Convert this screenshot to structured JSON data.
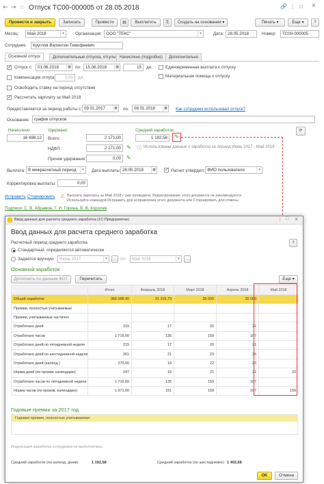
{
  "window": {
    "title": "Отпуск ТС00-000005 от 28.05.2018",
    "close": "×",
    "min": "–",
    "restore": "□"
  },
  "toolbar": {
    "post_close": "Провести и закрыть",
    "save": "Записать",
    "post": "Провести",
    "pay": "Выплатить",
    "create_basis": "Создать на основании",
    "print": "Печать",
    "more": "Еще",
    "help": "?"
  },
  "header": {
    "month_label": "Месяц:",
    "month": "Май 2018",
    "org_label": "Организация:",
    "org": "ООО \"ТЕКС\"",
    "date_label": "Дата:",
    "date": "28.05.2018",
    "number_label": "Номер:",
    "number": "ТС00-000005",
    "employee_label": "Сотрудник:",
    "employee": "Круглов Валентин Тимофеевич"
  },
  "tabs": [
    "Основной отпуск",
    "Дополнительные отпуска, отгулы",
    "Начислено (подробно)",
    "Дополнительно"
  ],
  "vacation": {
    "leave_label": "Отпуск с:",
    "from": "01.06.2018",
    "to_label": "по:",
    "to": "15.06.2018",
    "days": "15",
    "days_unit": "дн.",
    "comp_label": "Компенсация отпуска",
    "comp_value": "0,00",
    "comp_unit": "дн.",
    "free_rate": "Освободить ставку на период отсутствия",
    "calc_salary": "Рассчитать зарплату за Май 2018",
    "single_pay": "Единовременная выплата к отпуску",
    "material_help": "Материальная помощь к отпуску",
    "period_label": "Предоставляется за период работы с:",
    "period_from": "09.01.2017",
    "period_to_label": "по:",
    "period_to": "08.01.2018",
    "used_link": "Как сотрудник использовал отпуск?",
    "basis_label": "Основание:",
    "basis": "график отпусков"
  },
  "calc": {
    "accrued_label": "Начислено",
    "accrued": "16 696,12",
    "withheld_label": "Удержано",
    "total_label": "Всего:",
    "total": "2 171,00",
    "ndfl_label": "НДФЛ:",
    "ndfl": "2 171,00",
    "other_label": "Прочие удержания:",
    "other": "0,00",
    "avg_label": "Средний заработок",
    "avg": "1 192,58",
    "avg_note": "Использованы данные о заработке за период Июнь 2017 - Май 2018"
  },
  "payout": {
    "label": "Выплата:",
    "type": "В межрасчетный период",
    "date_label": "Дата выплаты:",
    "date": "28.05.2018",
    "approve_label": "Расчет утвердил:",
    "approver": "ФИО пользователя",
    "correction_label": "Корректировка выплаты:",
    "correction": "0,00"
  },
  "footer": {
    "fix": "Исправить",
    "reverse": "Сторнировать",
    "warning": "Выплата зарплаты за Май 2018 г уже проведена. Редактирование этого документа не рекомендуется",
    "warning2": "Используйте командой Исправить для исправления этого документа или Сторнировать для отмены",
    "signatures": "Подписи: С. В. Абрамов, Г. И. Горина, В. В. Королев"
  },
  "dialog": {
    "title_bar": "Ввод данных для расчета среднего заработка (1С:Предприятие)",
    "heading": "Ввод данных для расчета среднего заработка",
    "help": "?",
    "period_label": "Расчетный период среднего заработка",
    "standard": "Стандартный, определяется автоматически",
    "manual": "Задается вручную",
    "manual_from": "Июнь 2017",
    "manual_to_label": "по:",
    "manual_to": "Май 2018",
    "section": "Основной заработок",
    "fill_btn": "Дополнить по данным ФОТ",
    "recalc_btn": "Перечитать",
    "more": "Еще",
    "columns": [
      "",
      "Итого",
      "Февраль 2018",
      "Март 2018",
      "Апрель 2018",
      "Май 2018"
    ],
    "rows": [
      [
        "Общий заработок",
        "366 098,40",
        "31 315,79",
        "35 000",
        "35 000",
        ""
      ],
      [
        "Премии, полностью учитываемые",
        "",
        "",
        "",
        "",
        ""
      ],
      [
        "Премии, учитываемые частично",
        "",
        "",
        "",
        "",
        ""
      ],
      [
        "Отработано дней",
        "215",
        "17",
        "20",
        "21",
        ""
      ],
      [
        "Отработано часов",
        "1 716,00",
        "135",
        "159",
        "167",
        ""
      ],
      [
        "Отработано дней по пятидневной неделе",
        "215",
        "17",
        "20",
        "21",
        ""
      ],
      [
        "Отработано дней по шестидневной неделе",
        "261",
        "21",
        "23",
        "25",
        ""
      ],
      [
        "Отработано дней (календ.)",
        "270,00",
        "19",
        "22",
        "23",
        ""
      ],
      [
        "Норма дней (по произв. календарю)",
        "247",
        "19",
        "21",
        "21",
        "20"
      ],
      [
        "Отработано часов по пятидневной неделе",
        "1 716,00",
        "135",
        "159",
        "167",
        ""
      ],
      [
        "Норма часов (по произв. календарю)",
        "1 971,00",
        "151",
        "159",
        "167",
        "159"
      ]
    ],
    "bonus_section": "Годовые премии за 2017 год",
    "bonus_row": "Годовая премия, полностью учитываемая",
    "indexation": "Индексация заработка сотрудника не выполнялась",
    "avg_calendar_label": "Средний заработок (по календ. дням):",
    "avg_calendar": "1 192,58",
    "avg_six_label": "Средний заработок (по шестидневке):",
    "avg_six": "1 402,68",
    "ok": "OK",
    "cancel": "Отмена"
  }
}
